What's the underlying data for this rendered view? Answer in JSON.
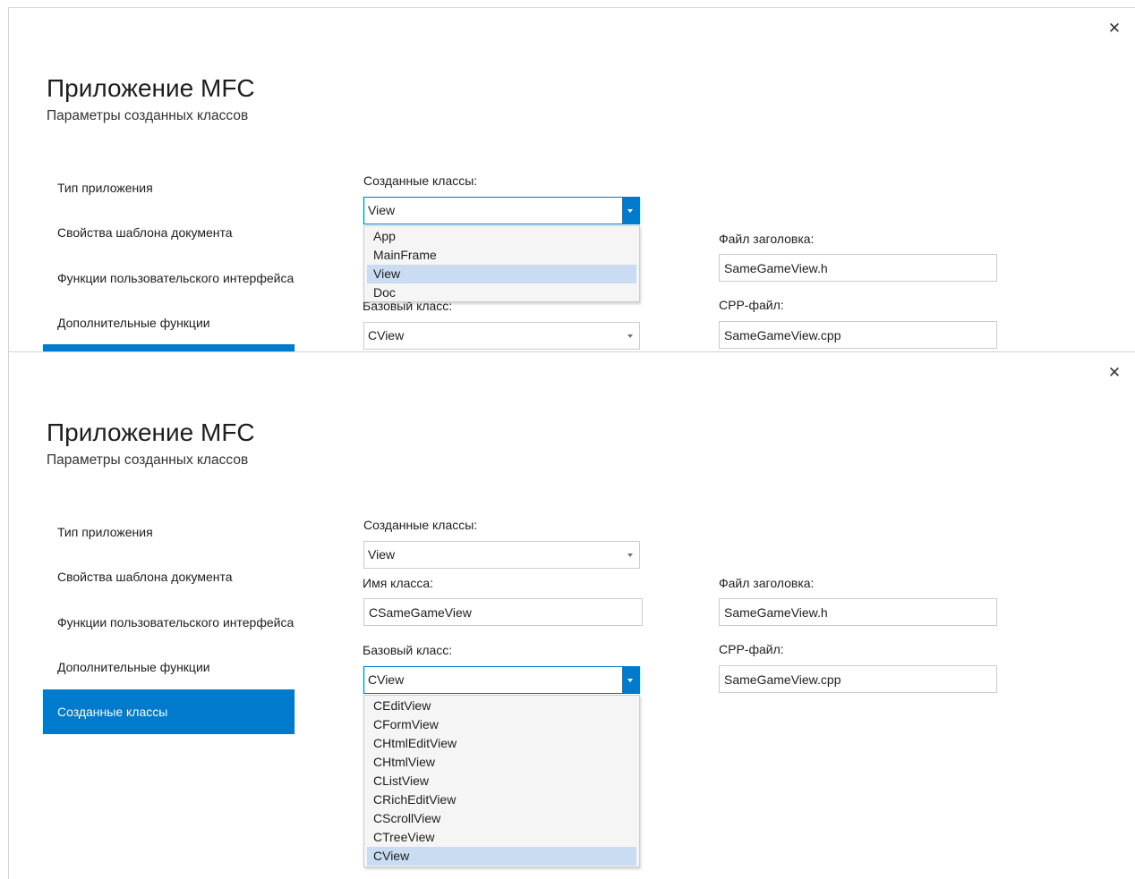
{
  "close_glyph": "✕",
  "top_panel": {
    "title": "Приложение MFC",
    "subtitle": "Параметры созданных классов",
    "nav": [
      {
        "label": "Тип приложения"
      },
      {
        "label": "Свойства шаблона документа"
      },
      {
        "label": "Функции пользовательского интерфейса"
      },
      {
        "label": "Дополнительные функции"
      }
    ],
    "created_classes_label": "Созданные классы:",
    "created_classes_value": "View",
    "created_classes_options": [
      "App",
      "MainFrame",
      "View",
      "Doc"
    ],
    "selected_option": "View",
    "base_class_label_partial": "Базовый класс:",
    "base_class_value": "CView",
    "header_file_label": "Файл заголовка:",
    "header_file_value": "SameGameView.h",
    "cpp_file_label": "CPP-файл:",
    "cpp_file_value": "SameGameView.cpp"
  },
  "bottom_panel": {
    "title": "Приложение MFC",
    "subtitle": "Параметры созданных классов",
    "nav": [
      {
        "label": "Тип приложения"
      },
      {
        "label": "Свойства шаблона документа"
      },
      {
        "label": "Функции пользовательского интерфейса"
      },
      {
        "label": "Дополнительные функции"
      },
      {
        "label": "Созданные классы"
      }
    ],
    "active_nav": "Созданные классы",
    "created_classes_label": "Созданные классы:",
    "created_classes_value": "View",
    "class_name_label": "Имя класса:",
    "class_name_value": "CSameGameView",
    "base_class_label": "Базовый класс:",
    "base_class_value": "CView",
    "base_class_options": [
      "CEditView",
      "CFormView",
      "CHtmlEditView",
      "CHtmlView",
      "CListView",
      "CRichEditView",
      "CScrollView",
      "CTreeView",
      "CView"
    ],
    "selected_option": "CView",
    "header_file_label": "Файл заголовка:",
    "header_file_value": "SameGameView.h",
    "cpp_file_label": "CPP-файл:",
    "cpp_file_value": "SameGameView.cpp"
  },
  "colors": {
    "accent": "#007acc",
    "selection": "#c9dcf2"
  }
}
